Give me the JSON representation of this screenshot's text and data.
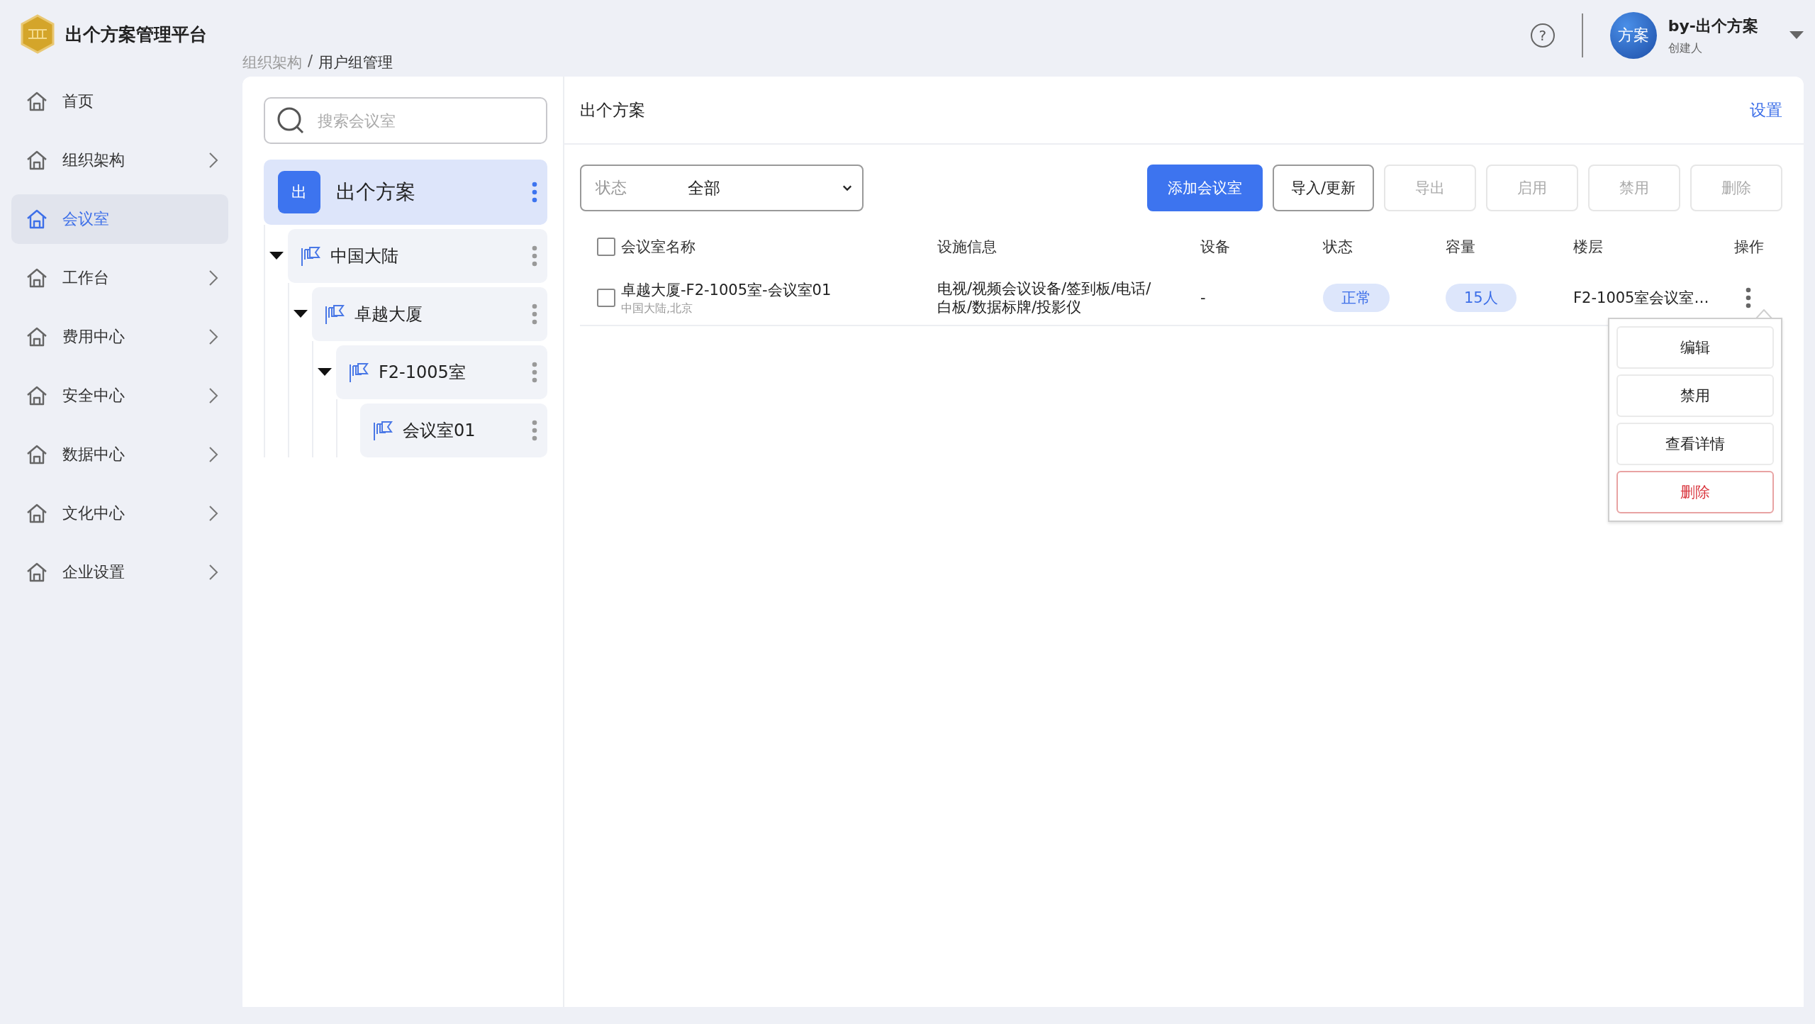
{
  "app": {
    "title": "出个方案管理平台"
  },
  "sidebar": {
    "items": [
      {
        "label": "首页",
        "selected": false,
        "has_submenu": false
      },
      {
        "label": "组织架构",
        "selected": false,
        "has_submenu": true
      },
      {
        "label": "会议室",
        "selected": true,
        "has_submenu": false
      },
      {
        "label": "工作台",
        "selected": false,
        "has_submenu": true
      },
      {
        "label": "费用中心",
        "selected": false,
        "has_submenu": true
      },
      {
        "label": "安全中心",
        "selected": false,
        "has_submenu": true
      },
      {
        "label": "数据中心",
        "selected": false,
        "has_submenu": true
      },
      {
        "label": "文化中心",
        "selected": false,
        "has_submenu": true
      },
      {
        "label": "企业设置",
        "selected": false,
        "has_submenu": true
      }
    ]
  },
  "breadcrumb": {
    "separator": "/",
    "items": [
      "组织架构",
      "用户组管理"
    ]
  },
  "header": {
    "help": "?",
    "user": {
      "avatar": "方案",
      "name": "by-出个方案",
      "role": "创建人"
    }
  },
  "tree": {
    "search": {
      "placeholder": "搜索会议室"
    },
    "root": {
      "badge": "出",
      "label": "出个方案",
      "selected": true,
      "children": [
        {
          "label": "中国大陆",
          "selected": false,
          "expanded": true,
          "children": [
            {
              "label": "卓越大厦",
              "selected": false,
              "expanded": true,
              "children": [
                {
                  "label": "F2-1005室",
                  "selected": false,
                  "expanded": true,
                  "children": [
                    {
                      "label": "会议室01",
                      "selected": false
                    }
                  ]
                }
              ]
            }
          ]
        }
      ]
    }
  },
  "panel": {
    "title": "出个方案",
    "settings_link": "设置",
    "filter": {
      "label": "状态",
      "value": "全部"
    },
    "buttons": [
      {
        "label": "添加会议室",
        "kind": "primary",
        "disabled": false
      },
      {
        "label": "导入/更新",
        "kind": "outline",
        "disabled": false
      },
      {
        "label": "导出",
        "kind": "outline",
        "disabled": true
      },
      {
        "label": "启用",
        "kind": "outline",
        "disabled": true
      },
      {
        "label": "禁用",
        "kind": "outline",
        "disabled": true
      },
      {
        "label": "删除",
        "kind": "outline",
        "disabled": true
      }
    ],
    "table": {
      "select_all": {
        "checked": false
      },
      "columns": [
        "会议室名称",
        "设施信息",
        "设备",
        "状态",
        "容量",
        "楼层",
        "操作"
      ],
      "rows": [
        {
          "checked": false,
          "name": "卓越大厦-F2-1005室-会议室01",
          "location": "中国大陆,北京",
          "facilities": "电视/视频会议设备/签到板/电话/白板/数据标牌/投影仪",
          "device": "-",
          "status": "正常",
          "capacity": "15人",
          "floor": "F2-1005室会议室…",
          "menu_open": true
        }
      ]
    },
    "row_menu": {
      "items": [
        {
          "label": "编辑",
          "kind": "default"
        },
        {
          "label": "禁用",
          "kind": "default"
        },
        {
          "label": "查看详情",
          "kind": "default"
        },
        {
          "label": "删除",
          "kind": "danger"
        }
      ]
    }
  }
}
